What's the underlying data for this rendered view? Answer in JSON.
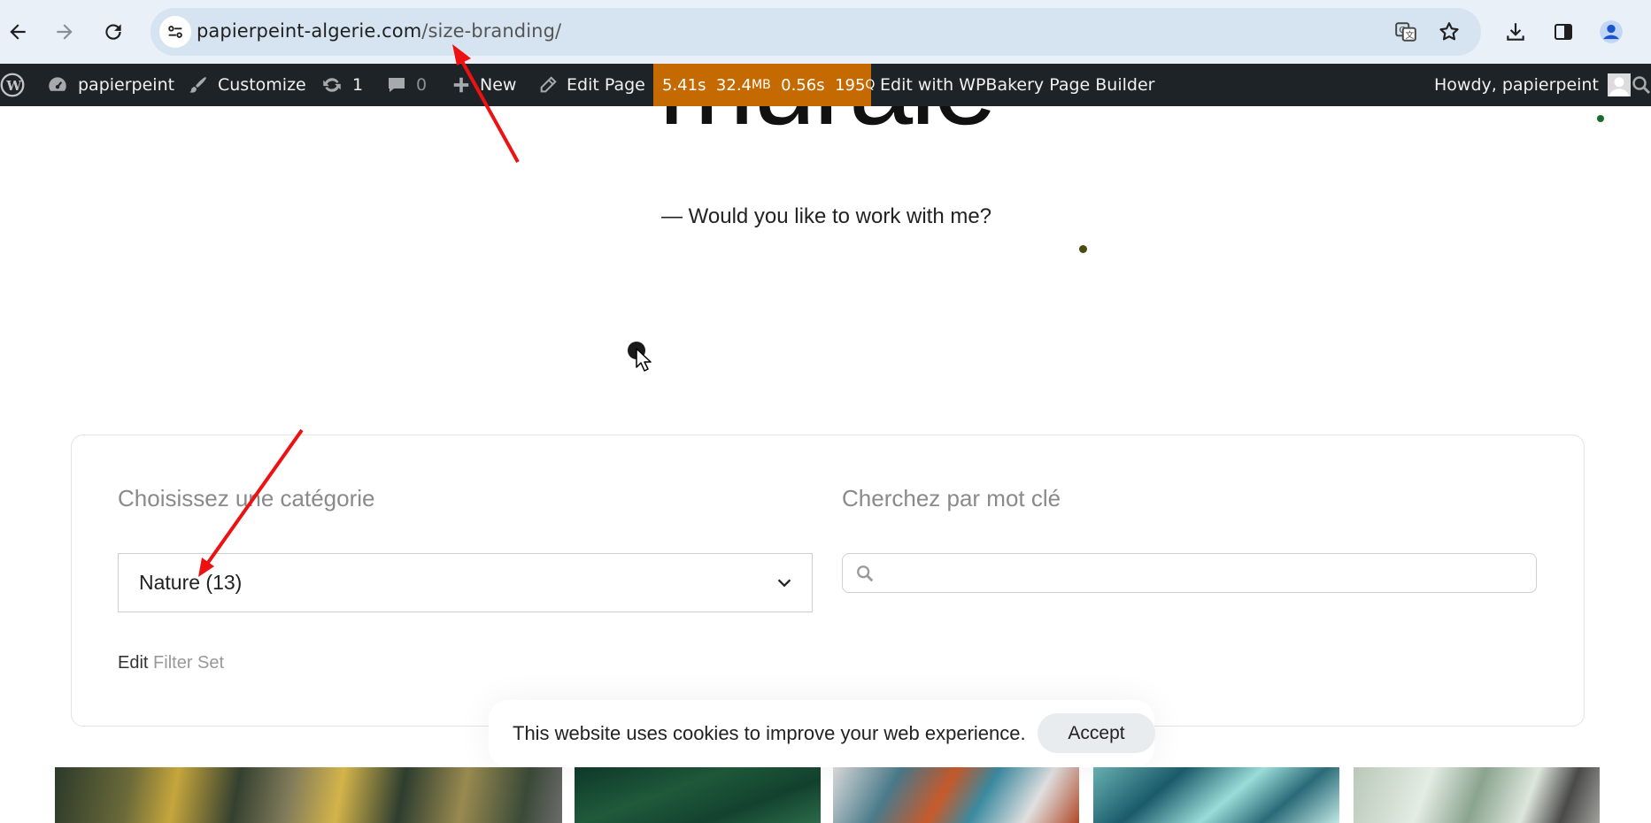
{
  "browser": {
    "url_host": "papierpeint-algerie.com",
    "url_path": "/size-branding/"
  },
  "admin_bar": {
    "site_name": "papierpeint",
    "customize": "Customize",
    "updates_count": "1",
    "comments_count": "0",
    "new_label": "New",
    "edit_page": "Edit Page",
    "qm": {
      "time": "5.41s",
      "memory": "32.4",
      "memory_unit": "MB",
      "db_time": "0.56s",
      "queries": "195",
      "queries_unit": "Q"
    },
    "wpbakery": "Edit with WPBakery Page Builder",
    "howdy": "Howdy, papierpeint"
  },
  "hero": {
    "title_partial": "murale",
    "subtitle": "— Would you like to work with me?"
  },
  "filters": {
    "category_label": "Choisissez une catégorie",
    "category_selected": "Nature (13)",
    "keyword_label": "Cherchez par mot clé",
    "keyword_value": "",
    "edit_label": "Edit",
    "filter_set_label": "Filter Set"
  },
  "cookie_banner": {
    "text": "This website uses cookies to improve your web experience.",
    "accept_label": "Accept"
  },
  "colors": {
    "admin_bar": "#1d2327",
    "qm_badge": "#c46a00",
    "chrome_bg": "#e9f0f8",
    "omnibox_bg": "#d6e4f1",
    "annotation_arrow": "#ee1111"
  }
}
